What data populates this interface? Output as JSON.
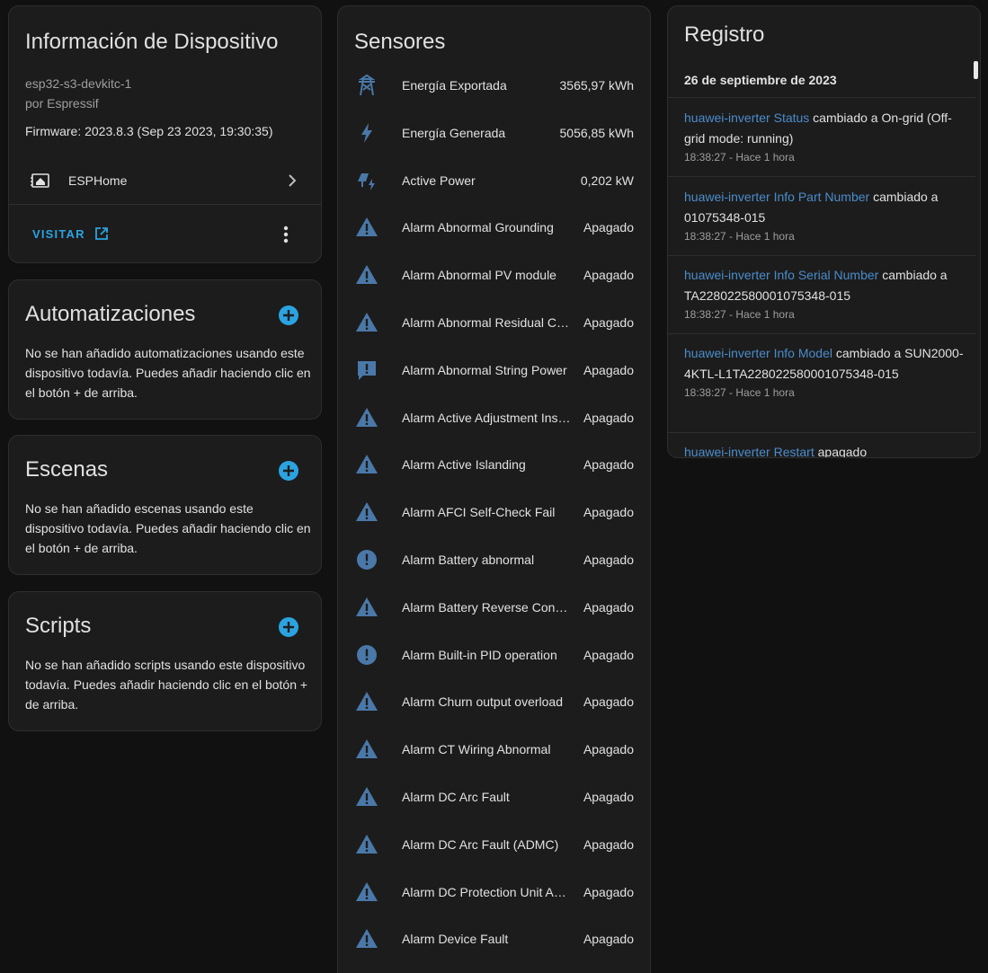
{
  "device": {
    "title": "Información de Dispositivo",
    "model": "esp32-s3-devkitc-1",
    "maker": "por Espressif",
    "firmware": "Firmware: 2023.8.3 (Sep 23 2023, 19:30:35)",
    "integration": "ESPHome",
    "visit_label": "VISITAR"
  },
  "automations": {
    "title": "Automatizaciones",
    "desc": "No se han añadido automatizaciones usando este dispositivo todavía. Puedes añadir haciendo clic en el botón + de arriba."
  },
  "scenes": {
    "title": "Escenas",
    "desc": "No se han añadido escenas usando este dispositivo todavía. Puedes añadir haciendo clic en el botón + de arriba."
  },
  "scripts": {
    "title": "Scripts",
    "desc": "No se han añadido scripts usando este dispositivo todavía. Puedes añadir haciendo clic en el botón + de arriba."
  },
  "sensors": {
    "title": "Sensores",
    "rows": [
      {
        "name": "Energía Exportada",
        "value": "3565,97 kWh",
        "icon": "transmission-tower-icon"
      },
      {
        "name": "Energía Generada",
        "value": "5056,85 kWh",
        "icon": "flash-icon"
      },
      {
        "name": "Active Power",
        "value": "0,202 kW",
        "icon": "solar-power-icon"
      },
      {
        "name": "Alarm Abnormal Grounding",
        "value": "Apagado",
        "icon": "alert-icon"
      },
      {
        "name": "Alarm Abnormal PV module",
        "value": "Apagado",
        "icon": "alert-icon"
      },
      {
        "name": "Alarm Abnormal Residual Current",
        "value": "Apagado",
        "icon": "alert-icon"
      },
      {
        "name": "Alarm Abnormal String Power",
        "value": "Apagado",
        "icon": "message-alert-icon"
      },
      {
        "name": "Alarm Active Adjustment Instruction",
        "value": "Apagado",
        "icon": "alert-icon"
      },
      {
        "name": "Alarm Active Islanding",
        "value": "Apagado",
        "icon": "alert-icon"
      },
      {
        "name": "Alarm AFCI Self-Check Fail",
        "value": "Apagado",
        "icon": "alert-icon"
      },
      {
        "name": "Alarm Battery abnormal",
        "value": "Apagado",
        "icon": "alert-circle-icon"
      },
      {
        "name": "Alarm Battery Reverse Connection",
        "value": "Apagado",
        "icon": "alert-icon"
      },
      {
        "name": "Alarm Built-in PID operation",
        "value": "Apagado",
        "icon": "alert-circle-icon"
      },
      {
        "name": "Alarm Churn output overload",
        "value": "Apagado",
        "icon": "alert-icon"
      },
      {
        "name": "Alarm CT Wiring Abnormal",
        "value": "Apagado",
        "icon": "alert-icon"
      },
      {
        "name": "Alarm DC Arc Fault",
        "value": "Apagado",
        "icon": "alert-icon"
      },
      {
        "name": "Alarm DC Arc Fault (ADMC)",
        "value": "Apagado",
        "icon": "alert-icon"
      },
      {
        "name": "Alarm DC Protection Unit Abnormal",
        "value": "Apagado",
        "icon": "alert-icon"
      },
      {
        "name": "Alarm Device Fault",
        "value": "Apagado",
        "icon": "alert-icon"
      }
    ]
  },
  "log": {
    "title": "Registro",
    "date": "26 de septiembre de 2023",
    "entries": [
      {
        "entity": "huawei-inverter Status",
        "text": " cambiado a On-grid (Off-grid mode: running)",
        "time": "18:38:27 - Hace 1 hora"
      },
      {
        "entity": "huawei-inverter Info Part Number",
        "text": " cambiado a 01075348-015",
        "time": "18:38:27 - Hace 1 hora"
      },
      {
        "entity": "huawei-inverter Info Serial Number",
        "text": " cambiado a TA2280225800010753​48-015",
        "time": "18:38:27 - Hace 1 hora"
      },
      {
        "entity": "huawei-inverter Info Model",
        "text": " cambiado a SUN2000-4KTL-L1TA228022580001075348-015",
        "time": "18:38:27 - Hace 1 hora"
      },
      {
        "entity": "huawei-inverter Restart",
        "text": " apagado",
        "time": ""
      }
    ]
  },
  "colors": {
    "accent": "#2ba3e0",
    "icon": "#4a78a8",
    "entity_link": "#4a8ccb",
    "card": "#1c1c1c",
    "background": "#111111"
  }
}
